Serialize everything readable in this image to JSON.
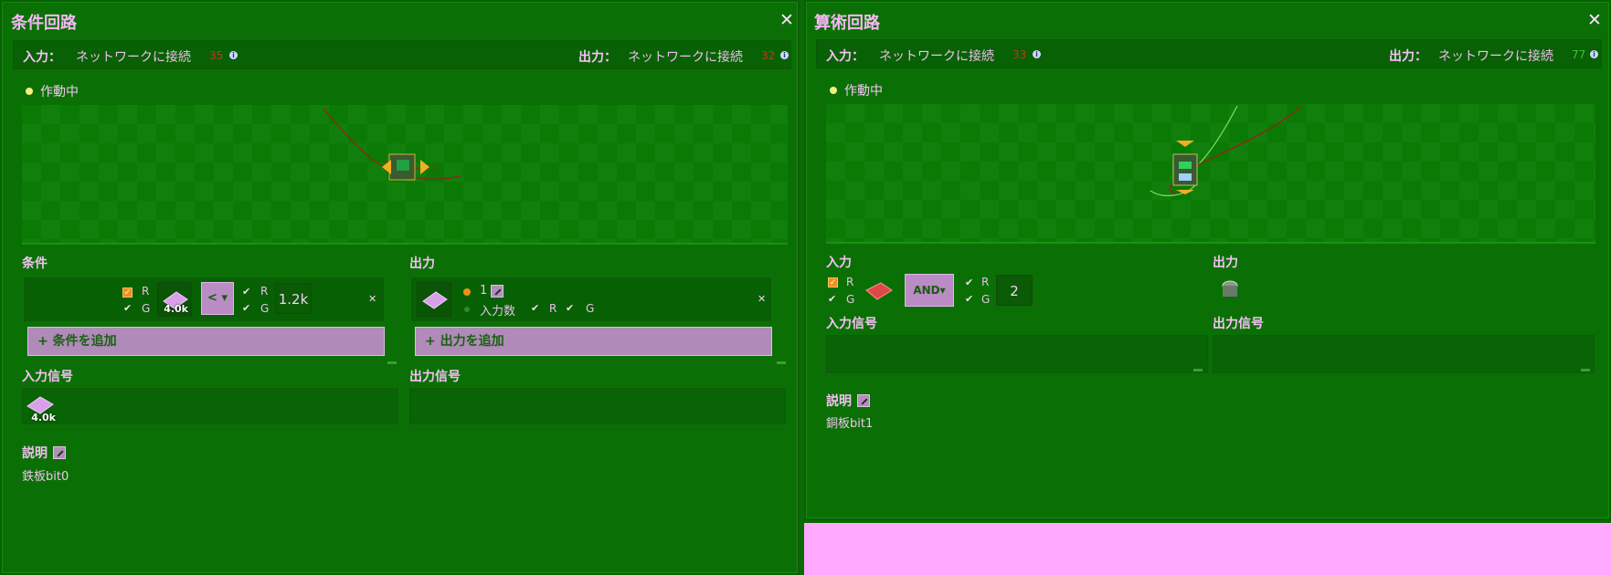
{
  "left": {
    "title": "条件回路",
    "input_label": "入力：",
    "input_text": "ネットワークに接続",
    "input_num": "35",
    "output_label": "出力：",
    "output_text": "ネットワークに接続",
    "output_num": "32",
    "status": "作動中",
    "condition_header": "条件",
    "output_header": "出力",
    "cond": {
      "r": "R",
      "g": "G",
      "first_count": "4.0k",
      "operator": "<",
      "r2": "R",
      "g2": "G",
      "constant": "1.2k"
    },
    "out": {
      "value": "1",
      "input_count": "入力数",
      "r": "R",
      "g": "G"
    },
    "add_condition": "条件を追加",
    "add_output": "出力を追加",
    "input_signals": "入力信号",
    "output_signals": "出力信号",
    "input_signal_count": "4.0k",
    "desc_header": "説明",
    "desc_text": "鉄板bit0"
  },
  "right": {
    "title": "算術回路",
    "input_label": "入力：",
    "input_text": "ネットワークに接続",
    "input_num": "33",
    "output_label": "出力：",
    "output_text": "ネットワークに接続",
    "output_num": "77",
    "status": "作動中",
    "input_header": "入力",
    "output_header": "出力",
    "arith": {
      "r": "R",
      "g": "G",
      "operator": "AND",
      "r2": "R",
      "g2": "G",
      "constant": "2"
    },
    "input_signals": "入力信号",
    "output_signals": "出力信号",
    "desc_header": "説明",
    "desc_text": "銅板bit1"
  },
  "colors": {
    "num_red": "#c03818",
    "num_green": "#40c040"
  },
  "icons": {
    "close": "close-icon",
    "info": "info-icon",
    "edit": "edit-icon",
    "iron_plate": "iron-plate-icon",
    "copper_plate": "copper-plate-icon",
    "wire_slot": "wire-icon"
  }
}
